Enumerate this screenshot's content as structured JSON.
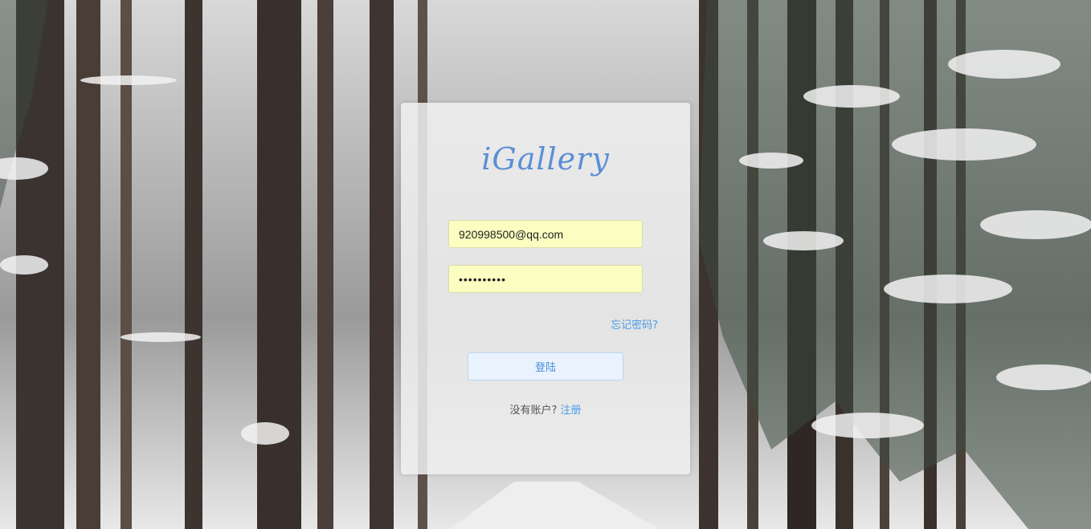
{
  "app": {
    "logo_text": "iGallery",
    "brand_color": "#5b8fd6"
  },
  "login_form": {
    "email_value": "920998500@qq.com",
    "password_value": "••••••••••",
    "forgot_password_label": "忘记密码?",
    "login_button_label": "登陆",
    "no_account_text": "没有账户?",
    "register_link_label": "注册"
  },
  "background": {
    "description_icon": "snowy-forest-image"
  }
}
